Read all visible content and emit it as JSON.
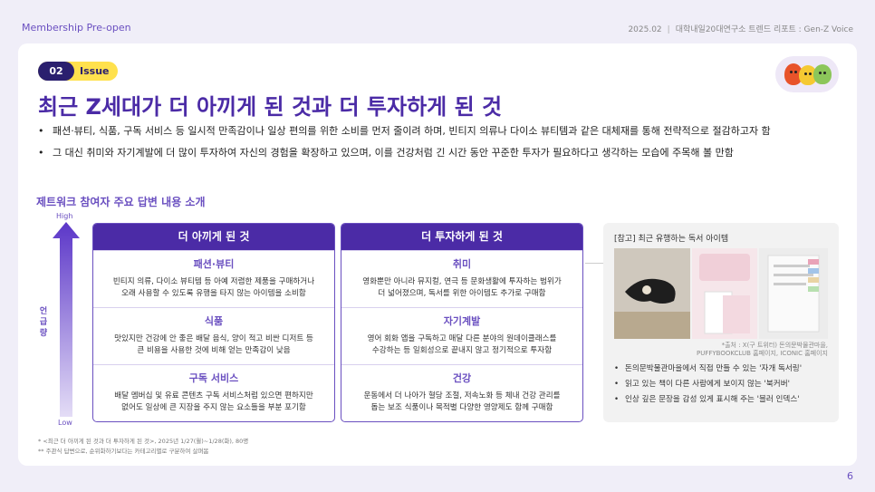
{
  "header": {
    "brand": "Membership Pre-open",
    "date": "2025.02",
    "divider": "|",
    "report": "대학내일20대연구소 트렌드 리포트 : Gen-Z Voice"
  },
  "issue": {
    "number": "02",
    "label": "Issue"
  },
  "title": "최근 Z세대가 더 아끼게 된 것과 더 투자하게 된 것",
  "bullets": [
    "패션·뷰티, 식품, 구독 서비스 등 일시적 만족감이나 일상 편의를 위한 소비를 먼저 줄이려 하며, 빈티지 의류나 다이소 뷰티템과 같은 대체재를 통해 전략적으로 절감하고자 함",
    "그 대신 취미와 자기계발에 더 많이 투자하여 자신의 경험을 확장하고 있으며, 이를 건강처럼 긴 시간 동안 꾸준한 투자가 필요하다고 생각하는 모습에 주목해 볼 만함"
  ],
  "section_title": "제트워크 참여자 주요 답변 내용 소개",
  "axis": {
    "high": "High",
    "low": "Low",
    "label": "언급량"
  },
  "save_panel": {
    "title": "더 아끼게 된 것",
    "items": [
      {
        "heading": "패션·뷰티",
        "desc": "빈티지 의류, 다이소 뷰티템 등 아예 저렴한 제품을 구매하거나\n오래 사용할 수 있도록 유행을 타지 않는 아이템을 소비함"
      },
      {
        "heading": "식품",
        "desc": "맛있지만 건강에 안 좋은 배달 음식, 양이 적고 비싼 디저트 등\n큰 비용을 사용한 것에 비해 얻는 만족감이 낮음"
      },
      {
        "heading": "구독 서비스",
        "desc": "배달 멤버십 및 유료 콘텐츠 구독 서비스처럼 있으면 편하지만\n없어도 일상에 큰 지장을 주지 않는 요소들을 부분 포기함"
      }
    ]
  },
  "invest_panel": {
    "title": "더 투자하게 된 것",
    "items": [
      {
        "heading": "취미",
        "desc": "영화뿐만 아니라 뮤지컬, 연극 등 문화생활에 투자하는 범위가\n더 넓어졌으며, 독서를 위한 아이템도 추가로 구매함"
      },
      {
        "heading": "자기계발",
        "desc": "영어 회화 앱을 구독하고 매달 다른 분야의 원데이클래스를\n수강하는 등 일회성으로 끝내지 않고 정기적으로 투자함"
      },
      {
        "heading": "건강",
        "desc": "운동에서 더 나아가 혈당 조절, 저속노화 등 체내 건강 관리를\n돕는 보조 식품이나 목적별 다양한 영양제도 함께 구매함"
      }
    ]
  },
  "reference": {
    "title": "[참고] 최근 유행하는 독서 아이템",
    "source": "*출처 : X(구 트위터) 돈의문박물관마을,\nPUFFYBOOKCLUB 홈페이지, ICONIC 홈페이지",
    "items": [
      "돈의문박물관마을에서 직접 만들 수 있는 '자개 독서링'",
      "읽고 있는 책이 다른 사람에게 보이지 않는 '북커버'",
      "인상 깊은 문장을 감성 있게 표시해 주는 '블러 인덱스'"
    ]
  },
  "notes": [
    "* <최근 더 아끼게 된 것과 더 투자하게 된 것>, 2025년 1/27(월)~1/28(화), 80명",
    "** 주관식 답변으로, 순위화하기보다는 카테고리별로 구분하여 살펴봄"
  ],
  "page_number": "6",
  "colors": {
    "accent": "#4b2ba6",
    "accent_light": "#6a4fc0",
    "tag": "#ffe14d"
  }
}
